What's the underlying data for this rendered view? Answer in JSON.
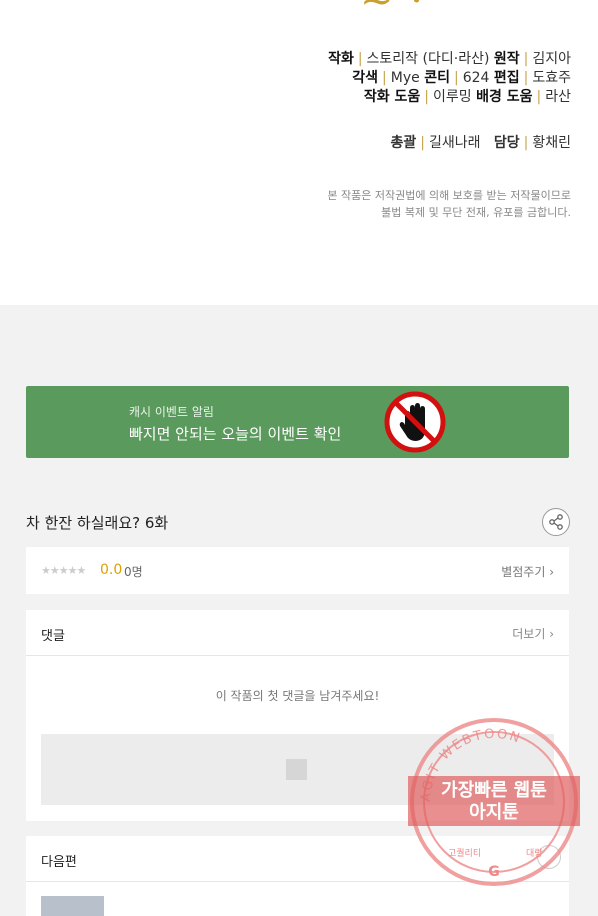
{
  "credits": {
    "line1": [
      {
        "role": "작화",
        "name": "스토리작 (다디·라산)"
      },
      {
        "role": "원작",
        "name": "김지아"
      }
    ],
    "line2": [
      {
        "role": "각색",
        "name": "Mye"
      },
      {
        "role": "콘티",
        "name": "624"
      },
      {
        "role": "편집",
        "name": "도효주"
      }
    ],
    "line3": [
      {
        "role": "작화 도움",
        "name": "이루밍"
      },
      {
        "role": "배경 도움",
        "name": "라산"
      }
    ],
    "staff": [
      {
        "role": "총괄",
        "name": "길새나래"
      },
      {
        "role": "담당",
        "name": "황채린"
      }
    ],
    "notice_line1": "본 작품은 저작권법에 의해 보호를 받는 저작물이므로",
    "notice_line2": "불법 복제 및 무단 전재, 유포를 금합니다."
  },
  "banner": {
    "subtitle": "캐시 이벤트 알림",
    "title": "빠지면 안되는 오늘의 이벤트 확인",
    "bg_color": "#5a9a5c"
  },
  "episode": {
    "title": "차 한잔 하실래요? 6화",
    "share_icon": "share-icon"
  },
  "rating": {
    "stars": "★★★★★",
    "score": "0.0",
    "count": "0명",
    "rate_label": "별점주기 ›"
  },
  "comments": {
    "header": "댓글",
    "more_label": "더보기 ›",
    "empty_text": "이 작품의 첫 댓글을 남겨주세요!"
  },
  "next": {
    "header": "다음편"
  },
  "watermark": {
    "arc_text": "AGIT WEBTOON",
    "line1": "가장빠른 웹툰",
    "line2": "아지툰",
    "bottom_left": "고퀄리티",
    "bottom_right": "대량",
    "color": "#e05050"
  }
}
